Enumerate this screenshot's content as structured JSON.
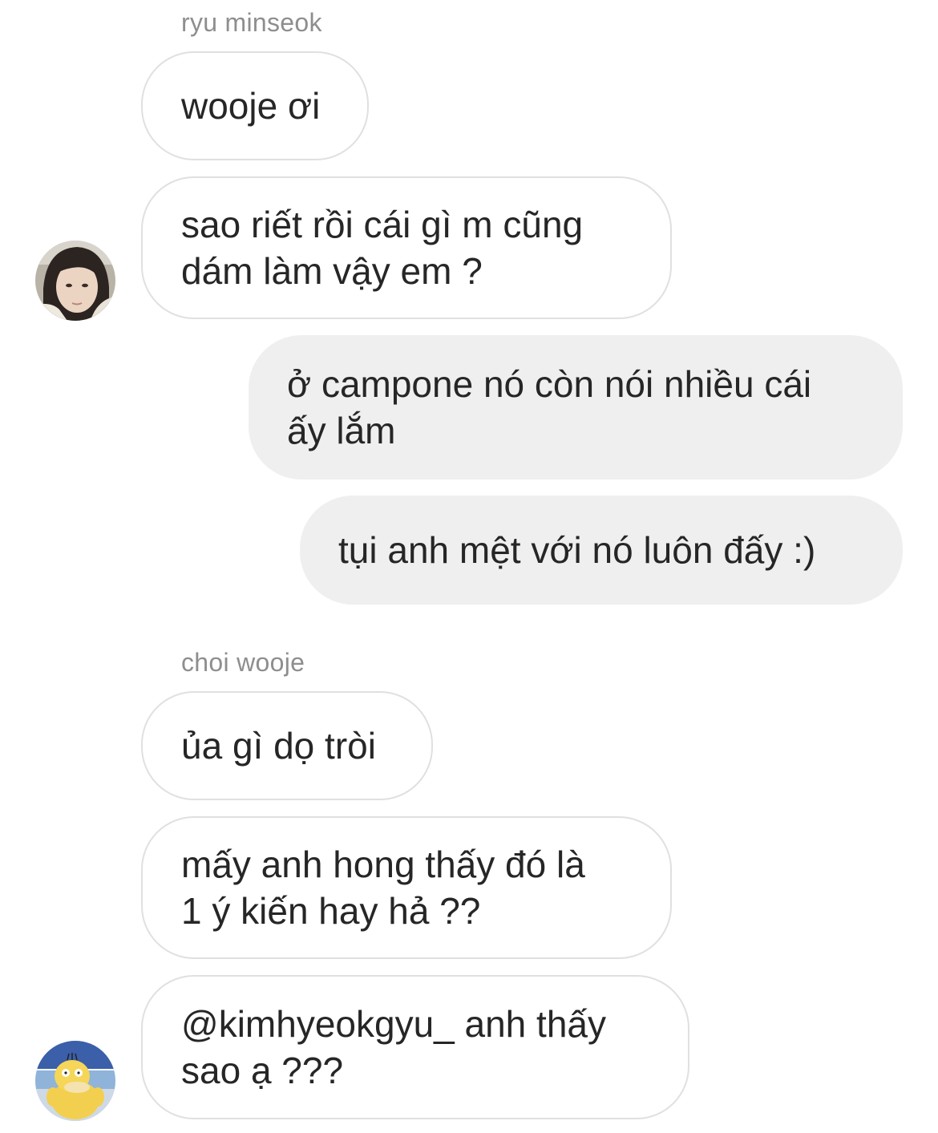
{
  "thread": {
    "groups": [
      {
        "sender": "ryu minseok",
        "messages": [
          "wooje ơi",
          "sao riết rồi cái gì m cũng\ndám làm vậy em ?"
        ]
      },
      {
        "sender": "",
        "outgoing": true,
        "messages": [
          "ở campone nó còn nói nhiều cái\nấy lắm",
          "tụi anh mệt với nó luôn đấy :)"
        ]
      },
      {
        "sender": "choi wooje",
        "messages": [
          "ủa gì dọ tròi",
          "mấy anh hong thấy đó là\n1 ý kiến hay hả ??",
          "@kimhyeokgyu_ anh thấy\nsao ạ ???"
        ]
      }
    ]
  },
  "avatars": {
    "ryu_minseok": "user-photo-avatar",
    "choi_wooje": "yellow-duck-avatar"
  },
  "colors": {
    "incoming_bubble_border": "#e0e0e0",
    "outgoing_bubble_bg": "#efefef",
    "text": "#262626",
    "sender_name": "#8e8e8e"
  }
}
